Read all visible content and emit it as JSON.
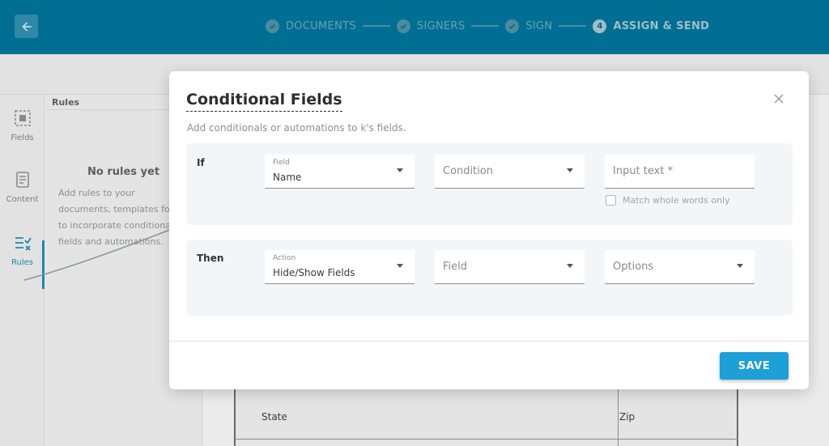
{
  "header": {
    "steps": [
      {
        "label": "DOCUMENTS",
        "state": "done"
      },
      {
        "label": "SIGNERS",
        "state": "done"
      },
      {
        "label": "SIGN",
        "state": "done"
      },
      {
        "label": "ASSIGN & SEND",
        "state": "active",
        "number": "4"
      }
    ]
  },
  "sidebar": {
    "items": [
      {
        "label": "Fields",
        "icon": "fields-icon"
      },
      {
        "label": "Content",
        "icon": "content-icon"
      },
      {
        "label": "Rules",
        "icon": "rules-icon",
        "active": true
      }
    ]
  },
  "rules_panel": {
    "title": "Rules",
    "empty_title": "No rules yet",
    "empty_desc": "Add rules to your documents, templates forms to incorporate conditional fields and automations."
  },
  "document": {
    "state_label": "State",
    "zip_label": "Zip"
  },
  "modal": {
    "title": "Conditional Fields",
    "subtitle": "Add conditionals or automations to k's fields.",
    "if_label": "If",
    "then_label": "Then",
    "if_row": {
      "field_small": "Field",
      "field_value": "Name",
      "condition_placeholder": "Condition",
      "input_placeholder": "Input text *",
      "match_label": "Match whole words only"
    },
    "then_row": {
      "action_small": "Action",
      "action_value": "Hide/Show Fields",
      "field_placeholder": "Field",
      "options_placeholder": "Options"
    },
    "save_label": "SAVE"
  },
  "colors": {
    "header_bg": "#016f93",
    "accent": "#1d9fd8",
    "active_rail": "#1f86ad"
  }
}
